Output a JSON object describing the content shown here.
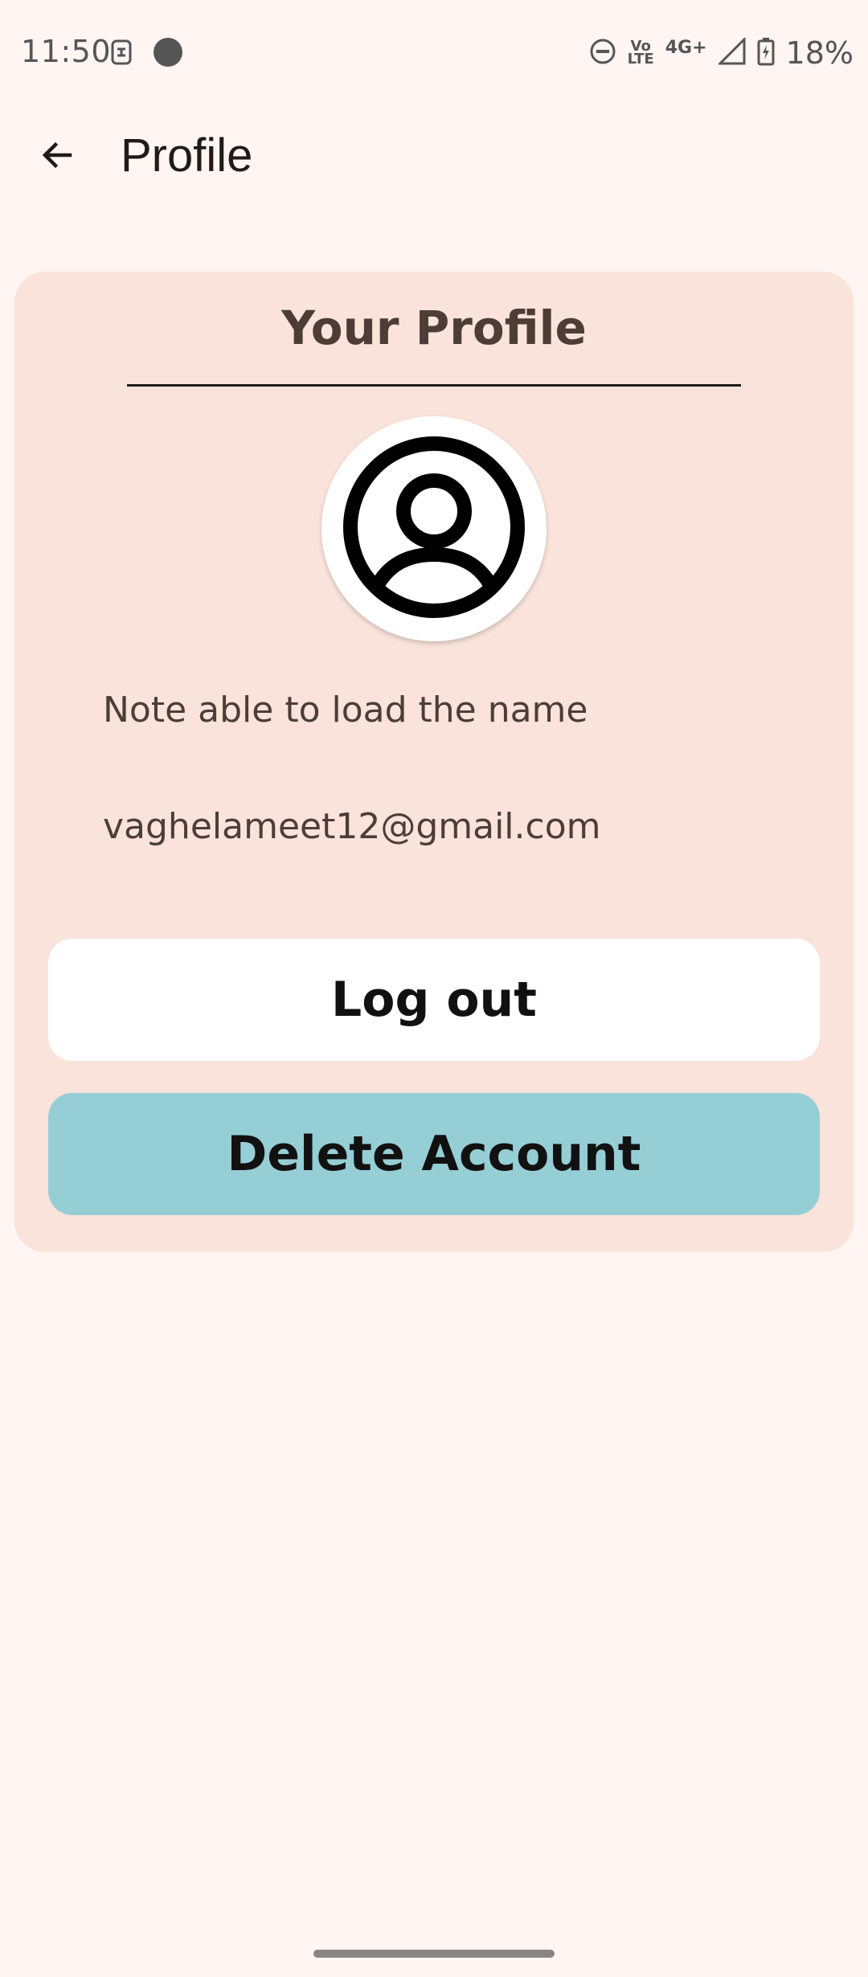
{
  "status_bar": {
    "time": "11:50",
    "network_top": "Vo",
    "network_bottom": "LTE",
    "network_type": "4G+",
    "battery": "18%",
    "icons": [
      "sim-notification-icon",
      "dot-notification-icon",
      "do-not-disturb-icon",
      "volte-icon",
      "signal-icon",
      "battery-charging-icon"
    ]
  },
  "app_bar": {
    "title": "Profile",
    "back_icon": "arrow-back-icon"
  },
  "card": {
    "heading": "Your Profile",
    "avatar_icon": "account-circle-icon",
    "name": "Note able to load the name",
    "email": "vaghelameet12@gmail.com",
    "logout_label": "Log out",
    "delete_label": "Delete Account"
  },
  "colors": {
    "background": "#fff5f2",
    "card": "#f9e3da",
    "heading_text": "#4e3d35",
    "logout_button": "#ffffff",
    "delete_button": "#96ced5"
  }
}
